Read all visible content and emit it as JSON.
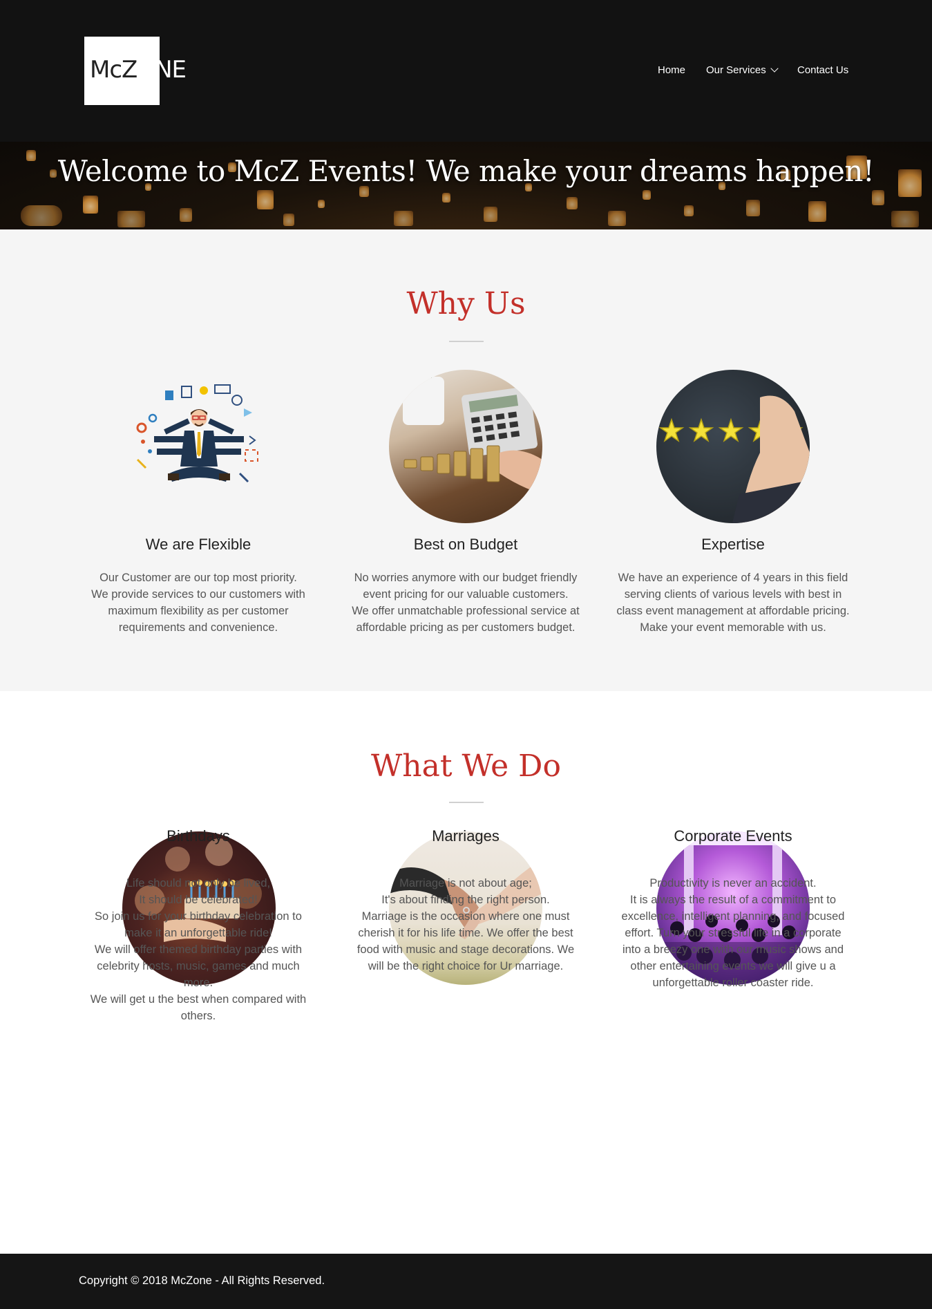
{
  "brand": {
    "logo_dark": "McZ",
    "logo_light": "ONE"
  },
  "nav": [
    {
      "label": "Home"
    },
    {
      "label": "Our Services"
    },
    {
      "label": "Contact Us"
    }
  ],
  "banner": {
    "title": "Welcome to McZ Events! We make your dreams happen!"
  },
  "why_us": {
    "title": "Why Us",
    "cards": [
      {
        "title": "We are Flexible",
        "lines": [
          "Our Customer are our top most priority.",
          "We provide services to our customers with",
          "maximum flexibility as per customer",
          "requirements and convenience."
        ]
      },
      {
        "title": "Best on Budget",
        "lines": [
          "No worries anymore with our budget friendly",
          "event pricing for our valuable customers.",
          "We offer unmatchable professional service at",
          "affordable pricing as per customers budget."
        ]
      },
      {
        "title": "Expertise",
        "lines": [
          "We have an experience of 4 years in this field",
          "serving clients of various levels with best in",
          "class event management at affordable pricing.",
          "Make your event memorable with us."
        ]
      }
    ]
  },
  "what_we_do": {
    "title": "What We Do",
    "cards": [
      {
        "title": "Birthdays",
        "lines": [
          "Life should not only be lived,",
          "It should be celebrated!",
          "So join us for your birthday celebration to",
          "make it an unforgettable ride!",
          "We will offer themed birthday parties with",
          "celebrity hosts, music, games and much",
          "more.",
          "We will get u the best when compared with",
          "others."
        ]
      },
      {
        "title": "Marriages",
        "lines": [
          "Marriage is not about age;",
          "It's about finding the right person.",
          "Marriage is the occasion where one must",
          "cherish it for his life time. We offer the best",
          "food with music and stage decorations. We",
          "will be the right choice for Ur marriage."
        ]
      },
      {
        "title": "Corporate Events",
        "lines": [
          "Productivity is never an accident.",
          "It is always the result of a commitment to",
          "excellence, intelligent planning, and focused",
          "effort. Turn your stressful life in a corporate",
          "into a breezy one with our music shows and",
          "other entertaining events we will give u a",
          "unforgettable roller coaster ride."
        ]
      }
    ]
  },
  "footer": {
    "copyright": "Copyright © 2018 McZone - All Rights Reserved."
  },
  "colors": {
    "accent": "#c3302a",
    "header_bg": "#121212",
    "section_bg": "#f5f5f5",
    "footer_bg": "#151515"
  }
}
